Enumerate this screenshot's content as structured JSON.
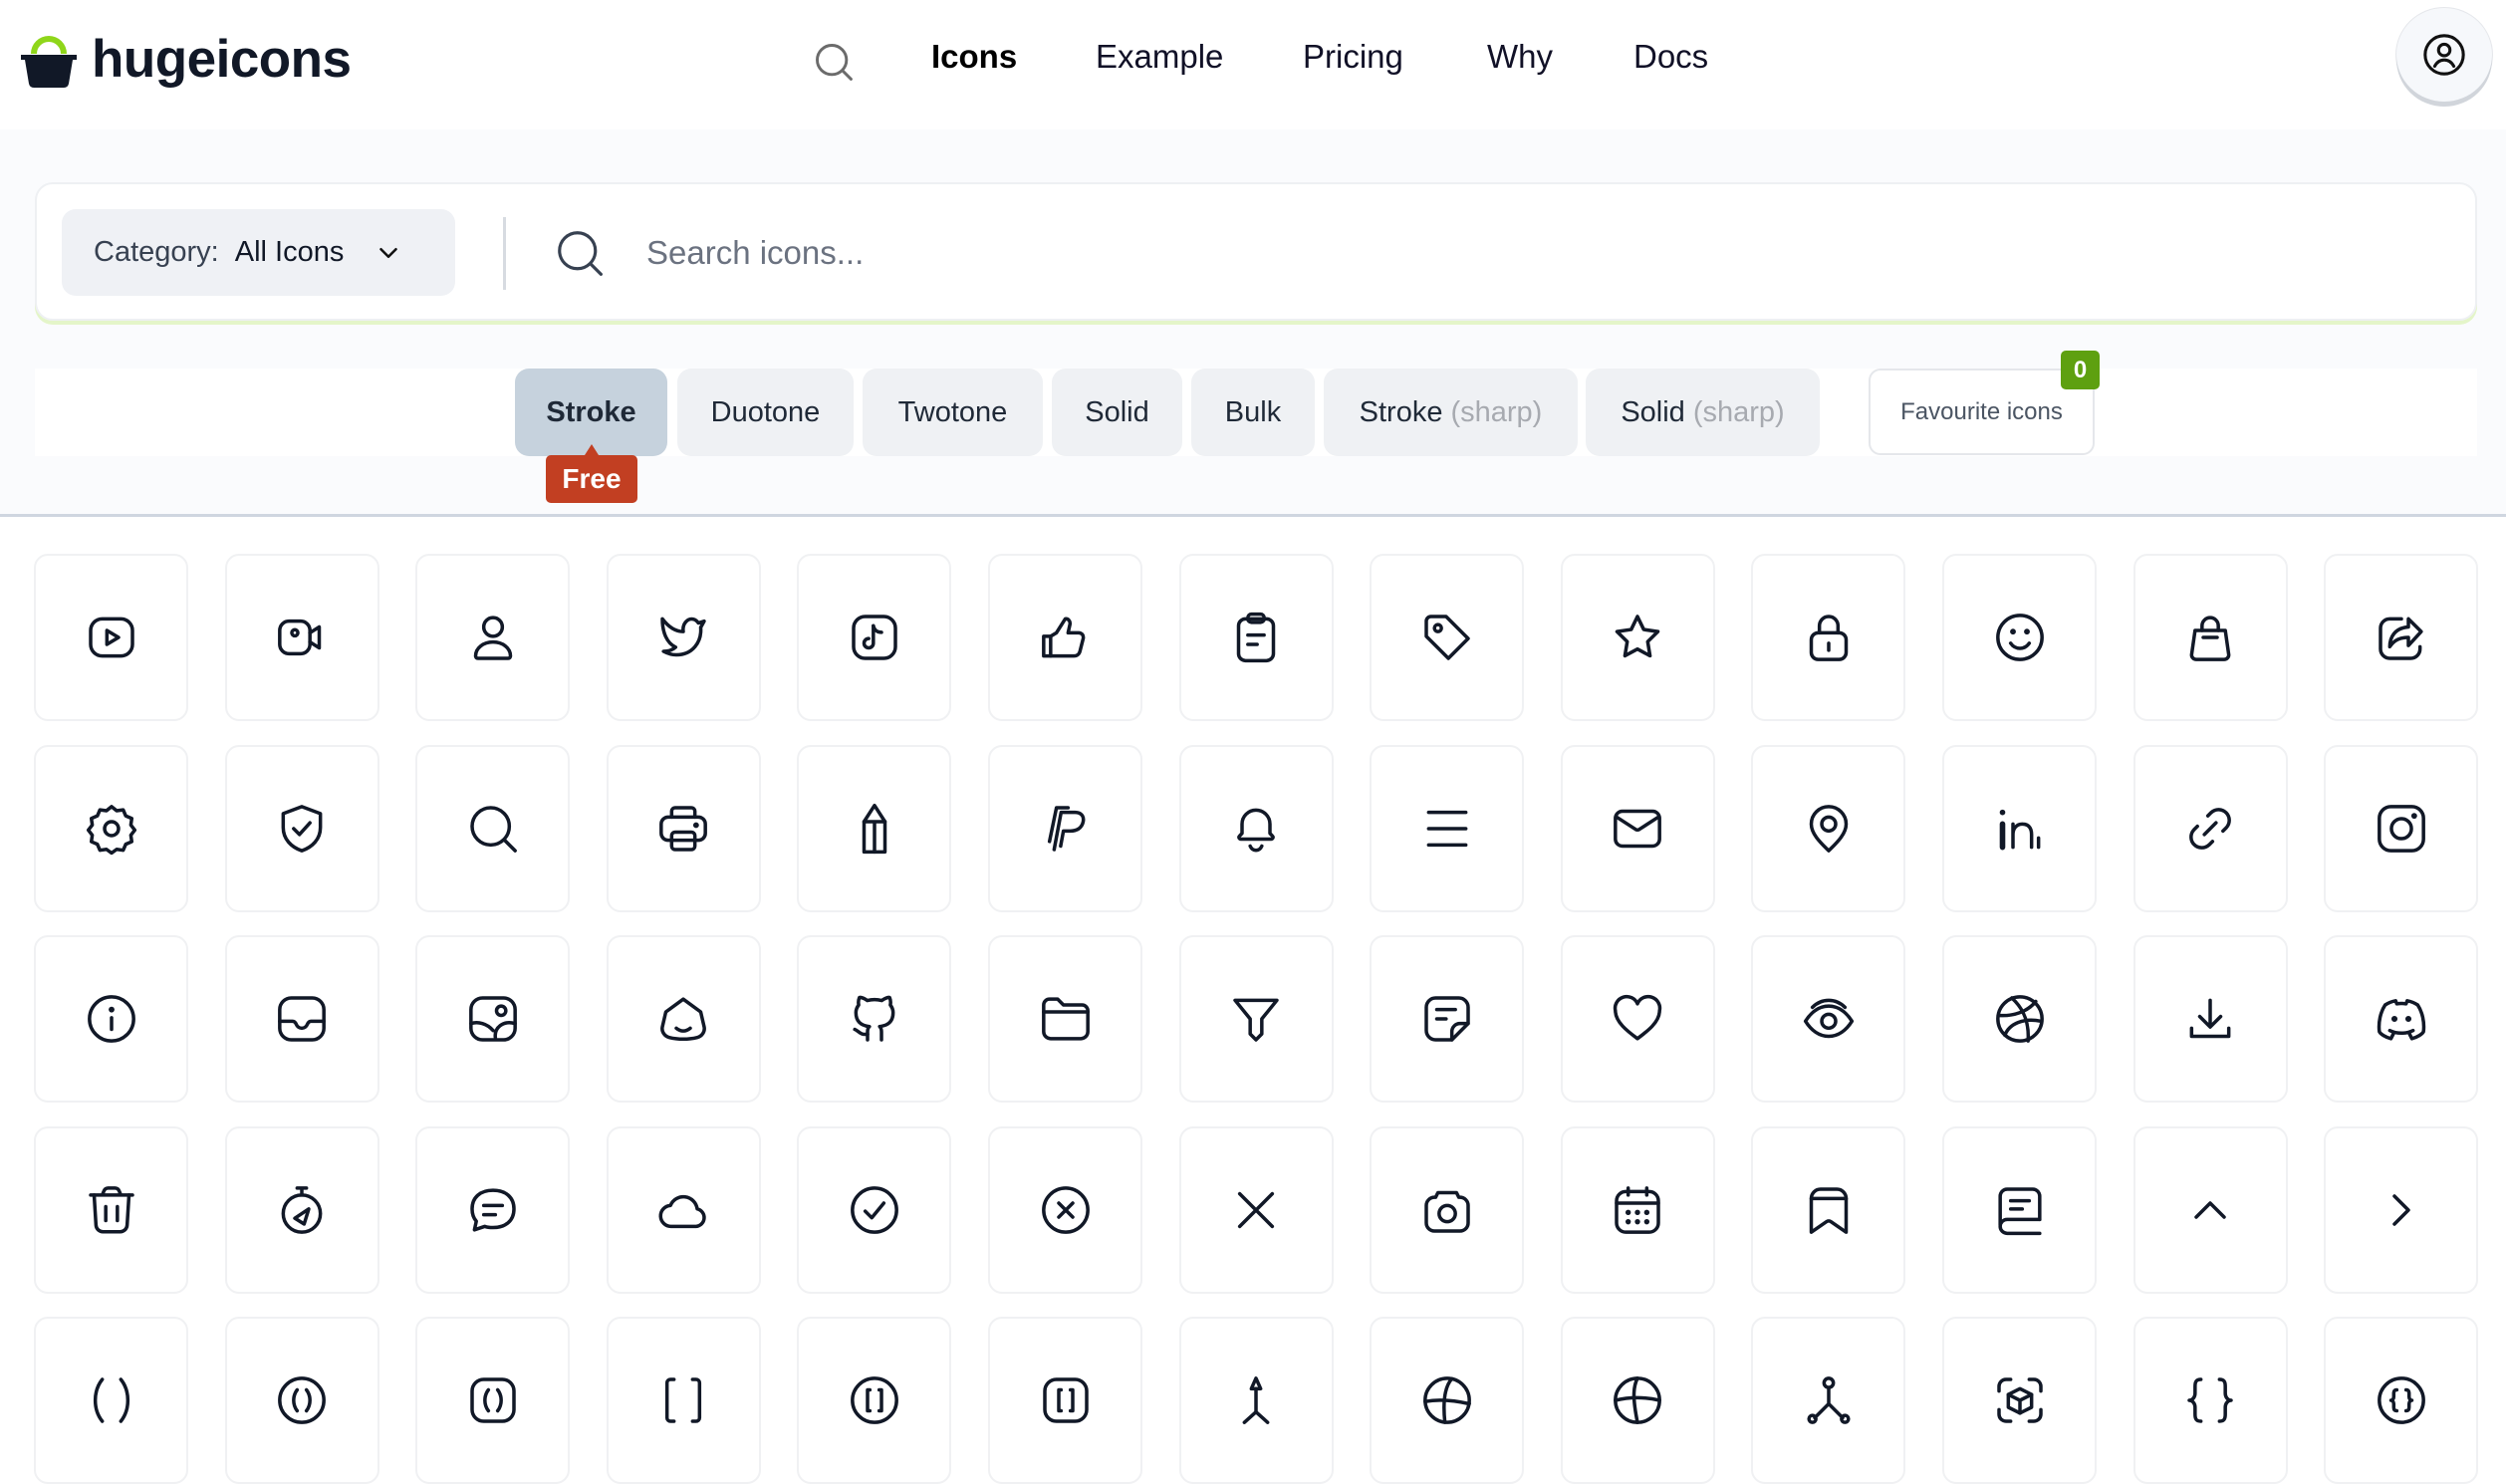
{
  "header": {
    "brand": "hugeicons",
    "logo_colors": {
      "basket": "#111827",
      "handle": "#8fd61a"
    },
    "nav": [
      {
        "label": "Icons",
        "active": true
      },
      {
        "label": "Example",
        "active": false
      },
      {
        "label": "Pricing",
        "active": false
      },
      {
        "label": "Why",
        "active": false
      },
      {
        "label": "Docs",
        "active": false
      }
    ],
    "nav_search_icon": "search-icon",
    "account_icon": "user-circle-icon"
  },
  "search": {
    "category_label": "Category:",
    "category_value": "All Icons",
    "placeholder": "Search icons...",
    "value": ""
  },
  "styles": {
    "tabs": [
      {
        "label": "Stroke",
        "suffix": "",
        "active": true
      },
      {
        "label": "Duotone",
        "suffix": "",
        "active": false
      },
      {
        "label": "Twotone",
        "suffix": "",
        "active": false
      },
      {
        "label": "Solid",
        "suffix": "",
        "active": false
      },
      {
        "label": "Bulk",
        "suffix": "",
        "active": false
      },
      {
        "label": "Stroke",
        "suffix": "(sharp)",
        "active": false
      },
      {
        "label": "Solid",
        "suffix": "(sharp)",
        "active": false
      }
    ],
    "free_badge": "Free",
    "favourites_label": "Favourite icons",
    "favourites_count": "0",
    "accent_colors": {
      "free": "#c23f22",
      "count": "#5ea010",
      "active_tab": "#c6d2dd"
    }
  },
  "icons": [
    [
      "youtube",
      "video",
      "user",
      "twitter",
      "tiktok",
      "thumbs-up",
      "clipboard",
      "tag",
      "star",
      "lock",
      "smile",
      "shopping-bag",
      "share"
    ],
    [
      "settings",
      "shield-check",
      "search",
      "printer",
      "pencil",
      "paypal",
      "notification",
      "menu",
      "mail",
      "location",
      "linkedin",
      "link",
      "instagram"
    ],
    [
      "information-circle",
      "inbox",
      "image",
      "home",
      "github",
      "folder",
      "filter",
      "note",
      "heart",
      "view",
      "dribbble",
      "download",
      "discord"
    ],
    [
      "delete",
      "timer",
      "message",
      "cloud",
      "check-circle",
      "cancel-circle",
      "cancel",
      "camera",
      "calendar",
      "bookmark",
      "book",
      "arrow-up",
      "arrow-right"
    ],
    [
      "parentheses",
      "parentheses-circle",
      "parentheses-square",
      "square-bracket",
      "square-bracket-circle",
      "square-bracket-square",
      "location-arrow",
      "basketball",
      "volleyball",
      "hierarchy",
      "cube-scan",
      "curly-bracket",
      "curly-bracket-circle"
    ]
  ]
}
